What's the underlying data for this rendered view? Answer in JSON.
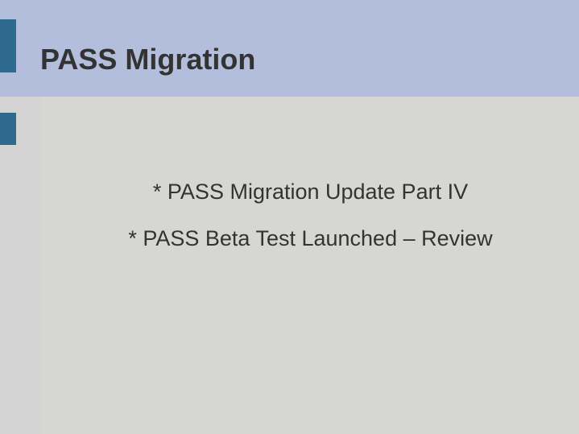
{
  "slide": {
    "title": "PASS Migration",
    "bullets": [
      "*  PASS Migration Update Part IV",
      "*  PASS Beta Test Launched – Review"
    ]
  }
}
